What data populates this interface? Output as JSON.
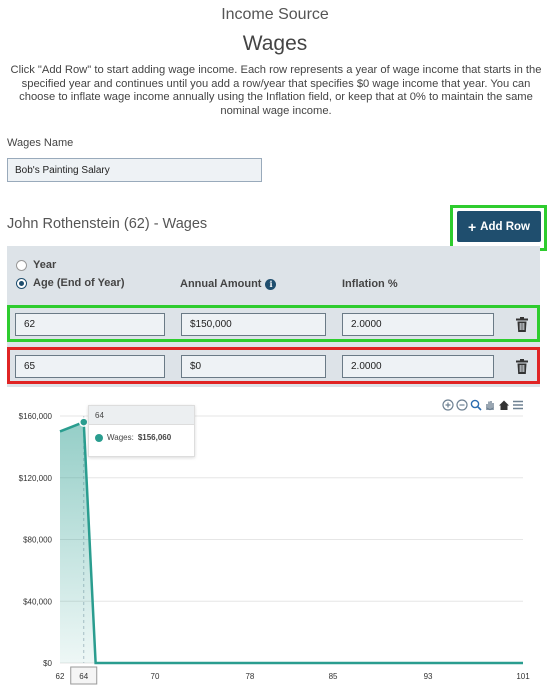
{
  "header": {
    "subtitle": "Income Source",
    "title": "Wages",
    "intro": "Click \"Add Row\" to start adding wage income. Each row represents a year of wage income that starts in the specified year and continues until you add a row/year that specifies $0 wage income that year. You can choose to inflate wage income annually using the Inflation field, or keep that at 0% to maintain the same nominal wage income."
  },
  "wages_name": {
    "label": "Wages Name",
    "value": "Bob's Painting Salary"
  },
  "section": {
    "title": "John Rothenstein (62) - Wages",
    "add_row_label": "Add Row"
  },
  "table": {
    "radio_year": "Year",
    "radio_age": "Age (End of Year)",
    "radio_selected": "Age (End of Year)",
    "col_amount": "Annual Amount",
    "col_inflation": "Inflation %",
    "rows": [
      {
        "age": "62",
        "amount": "$150,000",
        "inflation": "2.0000"
      },
      {
        "age": "65",
        "amount": "$0",
        "inflation": "2.0000"
      }
    ]
  },
  "colors": {
    "accent": "#1f4e6e",
    "series": "#2a9d8f",
    "highlight_green": "#2ecc2e",
    "highlight_red": "#e02424"
  },
  "tooltip": {
    "x": "64",
    "series_label": "Wages:",
    "value": "$156,060"
  },
  "chart_data": {
    "type": "area",
    "series": [
      {
        "name": "Wages",
        "x": [
          62,
          63,
          64,
          65,
          101
        ],
        "values": [
          150000,
          153000,
          156060,
          0,
          0
        ]
      }
    ],
    "x_ticks": [
      "62",
      "64",
      "70",
      "78",
      "85",
      "93",
      "101"
    ],
    "y_ticks": [
      "$160,000",
      "$120,000",
      "$80,000",
      "$40,000",
      "$0"
    ],
    "xlim": [
      62,
      101
    ],
    "ylim": [
      0,
      160000
    ],
    "highlight_x": "64",
    "grid": true
  }
}
